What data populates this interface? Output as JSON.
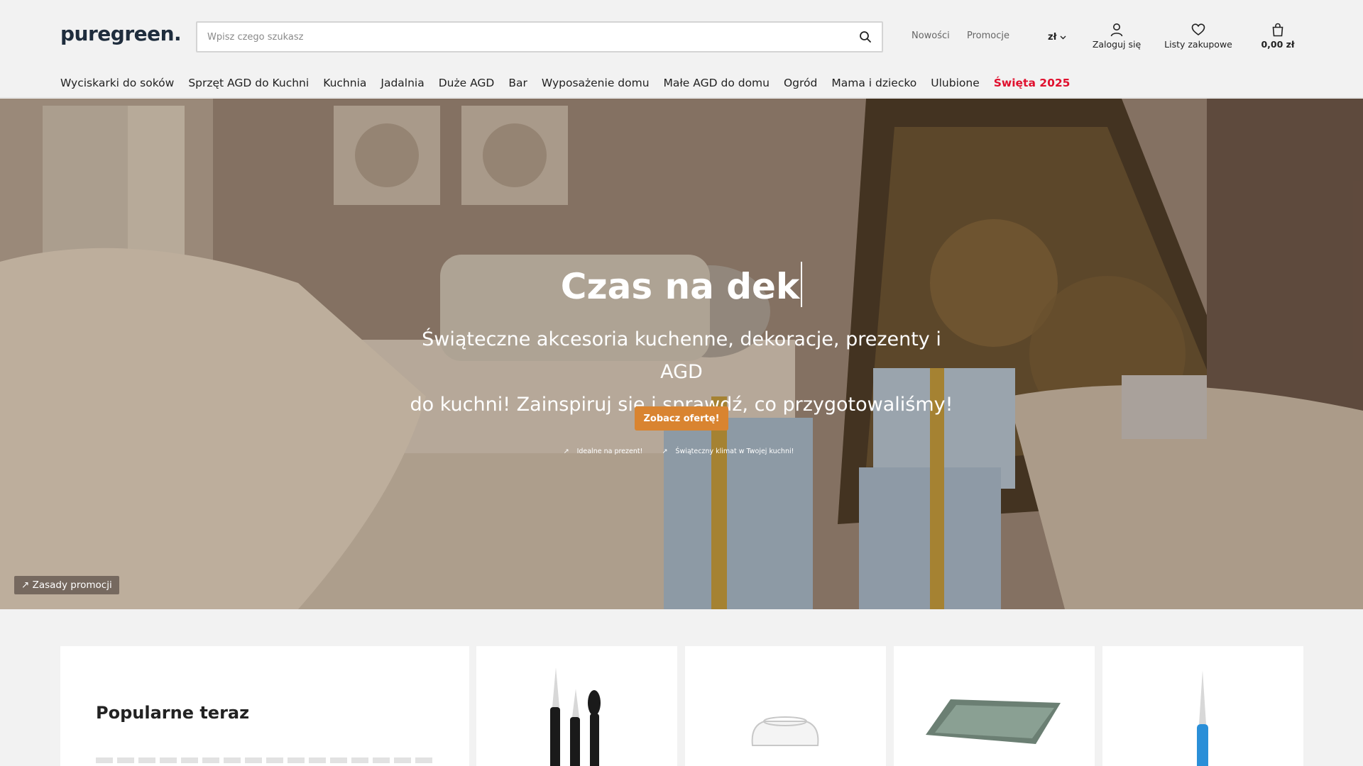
{
  "header": {
    "logo": "puregreen.",
    "search_placeholder": "Wpisz czego szukasz",
    "links": [
      "Nowości",
      "Promocje"
    ],
    "currency": "zł",
    "account_label": "Zaloguj się",
    "wishlist_label": "Listy zakupowe",
    "cart_total": "0,00 zł"
  },
  "nav": {
    "items": [
      "Wyciskarki do soków",
      "Sprzęt AGD do Kuchni",
      "Kuchnia",
      "Jadalnia",
      "Duże AGD",
      "Bar",
      "Wyposażenie domu",
      "Małe AGD do domu",
      "Ogród",
      "Mama i dziecko",
      "Ulubione"
    ],
    "highlight": "Święta 2025",
    "highlight_color": "#e0102e"
  },
  "hero": {
    "title": "Czas na dek",
    "subtitle_line1": "Świąteczne akcesoria kuchenne, dekoracje, prezenty i AGD",
    "subtitle_line2": "do kuchni! Zainspiruj się i sprawdź, co przygotowaliśmy!",
    "cta": "Zobacz ofertę!",
    "cta_color": "#d98430",
    "links": [
      "Idealne na prezent!",
      "Świąteczny klimat w Twojej kuchni!"
    ],
    "promo_rules": "Zasady promocji"
  },
  "products": {
    "heading": "Popularne teraz"
  }
}
